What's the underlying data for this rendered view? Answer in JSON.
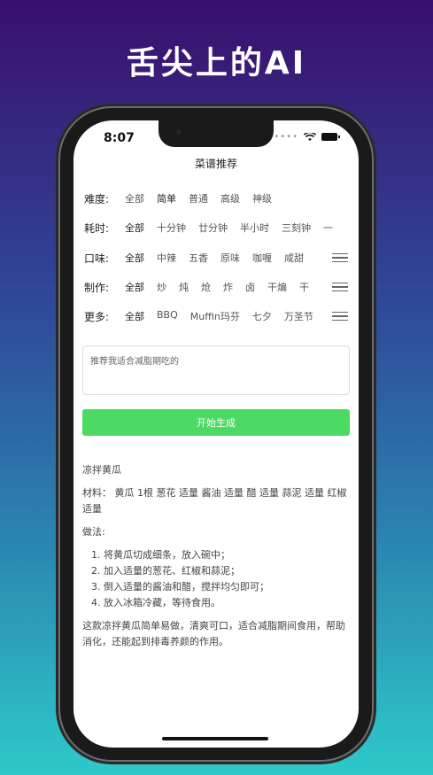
{
  "headline": "舌尖上的AI",
  "status": {
    "time": "8:07"
  },
  "nav": {
    "title": "菜谱推荐"
  },
  "filters": [
    {
      "label": "难度:",
      "options": [
        "全部",
        "简单",
        "普通",
        "高级",
        "神级"
      ],
      "active": 1,
      "menu": false
    },
    {
      "label": "耗时:",
      "options": [
        "全部",
        "十分钟",
        "廿分钟",
        "半小时",
        "三刻钟",
        "一"
      ],
      "active": 0,
      "menu": false
    },
    {
      "label": "口味:",
      "options": [
        "全部",
        "中辣",
        "五香",
        "原味",
        "咖喱",
        "咸甜"
      ],
      "active": 0,
      "menu": true
    },
    {
      "label": "制作:",
      "options": [
        "全部",
        "炒",
        "炖",
        "炝",
        "炸",
        "卤",
        "干煸",
        "干"
      ],
      "active": 0,
      "menu": true
    },
    {
      "label": "更多:",
      "options": [
        "全部",
        "BBQ",
        "Muffin玛芬",
        "七夕",
        "万圣节"
      ],
      "active": 0,
      "menu": true
    }
  ],
  "prompt": {
    "text": "推荐我适合减脂期吃的"
  },
  "generate_button": "开始生成",
  "result": {
    "title": "凉拌黄瓜",
    "materials": "材料： 黄瓜 1根 葱花 适量 酱油 适量 醋 适量 蒜泥 适量 红椒 适量",
    "method_label": "做法:",
    "steps": [
      "将黄瓜切成细条，放入碗中；",
      "加入适量的葱花、红椒和蒜泥；",
      "倒入适量的酱油和醋，搅拌均匀即可；",
      "放入冰箱冷藏，等待食用。"
    ],
    "summary": "这款凉拌黄瓜简单易做，清爽可口，适合减脂期间食用，帮助消化，还能起到排毒养颜的作用。"
  }
}
